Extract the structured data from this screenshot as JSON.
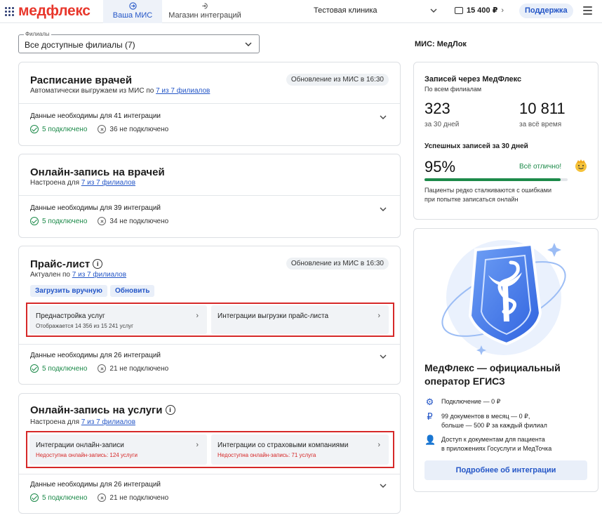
{
  "header": {
    "logo": "медфлекс",
    "tabs": [
      {
        "label": "Ваша МИС",
        "icon": "arrow-right-circle-icon"
      },
      {
        "label": "Магазин интеграций",
        "icon": "login-icon"
      }
    ],
    "clinic": "Тестовая клиника",
    "balance": "15 400 ₽",
    "support": "Поддержка"
  },
  "filter": {
    "label": "Филиалы",
    "value": "Все доступные филиалы (7)"
  },
  "cards": [
    {
      "title": "Расписание врачей",
      "subtitle_prefix": "Автоматически выгружаем из МИС по",
      "subtitle_link": "7 из 7 филиалов",
      "badge": "Обновление из МИС в 16:30",
      "need": "Данные необходимы для 41 интеграции",
      "ok": "5 подключено",
      "no": "36 не подключено"
    },
    {
      "title": "Онлайн-запись на врачей",
      "subtitle_prefix": "Настроена для",
      "subtitle_link": "7 из 7 филиалов",
      "need": "Данные необходимы для 39 интеграций",
      "ok": "5 подключено",
      "no": "34 не подключено"
    },
    {
      "title": "Прайс-лист",
      "subtitle_prefix": "Актуален по",
      "subtitle_link": "7 из 7 филиалов",
      "badge": "Обновление из МИС в 16:30",
      "buttons": [
        "Загрузить вручную",
        "Обновить"
      ],
      "tiles": [
        {
          "title": "Преднастройка услуг",
          "sub": "Отображается 14 356 из 15 241 услуг"
        },
        {
          "title": "Интеграции выгрузки прайс-листа",
          "sub": ""
        }
      ],
      "need": "Данные необходимы для 26 интеграций",
      "ok": "5 подключено",
      "no": "21 не подключено"
    },
    {
      "title": "Онлайн-запись на услуги",
      "subtitle_prefix": "Настроена для",
      "subtitle_link": "7 из 7 филиалов",
      "tiles": [
        {
          "title": "Интеграции онлайн-записи",
          "sub": "Недоступна онлайн-запись: 124 услуги"
        },
        {
          "title": "Интеграции со страховыми компаниями",
          "sub": "Недоступна онлайн-запись: 71 услуга"
        }
      ],
      "need": "Данные необходимы для 26 интеграций",
      "ok": "5 подключено",
      "no": "21 не подключено"
    }
  ],
  "right": {
    "mis": "МИС: МедЛок",
    "stats": {
      "title": "Записей через МедФлекс",
      "subtitle": "По всем филиалам",
      "v30": "323",
      "v30_label": "за 30 дней",
      "vall": "10 811",
      "vall_label": "за всё время",
      "success_title": "Успешных записей за 30 дней",
      "success_value": "95%",
      "success_fraction": 0.95,
      "success_status": "Всё отлично!",
      "note_line1": "Пациенты редко сталкиваются с ошибками",
      "note_line2": "при попытке записаться онлайн"
    },
    "egisz": {
      "title_line1": "МедФлекс — официальный",
      "title_line2": "оператор ЕГИСЗ",
      "features": [
        {
          "icon": "gear-icon",
          "line1": "Подключение — 0 ₽",
          "line2": ""
        },
        {
          "icon": "ruble-icon",
          "line1": "99 документов в месяц — 0 ₽,",
          "line2": "больше — 500 ₽ за каждый филиал"
        },
        {
          "icon": "user-icon",
          "line1": "Доступ к документам для пациента",
          "line2": "в приложениях Госуслуги и МедТочка"
        }
      ],
      "more": "Подробнее об интеграции"
    }
  },
  "colors": {
    "brand": "#e8372c",
    "accent": "#2456c7",
    "ok": "#1d8a4a",
    "error": "#d62828"
  }
}
